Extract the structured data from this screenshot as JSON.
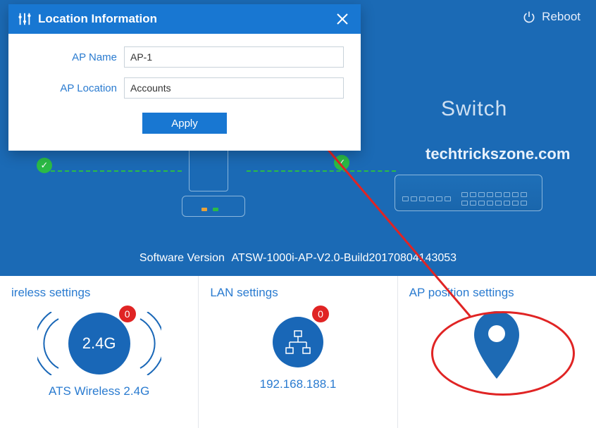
{
  "topbar": {
    "reboot_label": "Reboot"
  },
  "diagram": {
    "switch_label": "Switch",
    "watermark": "techtrickszone.com"
  },
  "version": {
    "label": "Software Version",
    "value": "ATSW-1000i-AP-V2.0-Build20170804143053"
  },
  "panels": {
    "wireless": {
      "title": "ireless settings",
      "badge": "0",
      "circle_text": "2.4G",
      "value": "ATS Wireless 2.4G"
    },
    "lan": {
      "title": "LAN settings",
      "badge": "0",
      "value": "192.168.188.1"
    },
    "position": {
      "title": "AP position settings"
    }
  },
  "modal": {
    "title": "Location Information",
    "ap_name_label": "AP Name",
    "ap_name_value": "AP-1",
    "ap_location_label": "AP Location",
    "ap_location_value": "Accounts",
    "apply_label": "Apply"
  }
}
